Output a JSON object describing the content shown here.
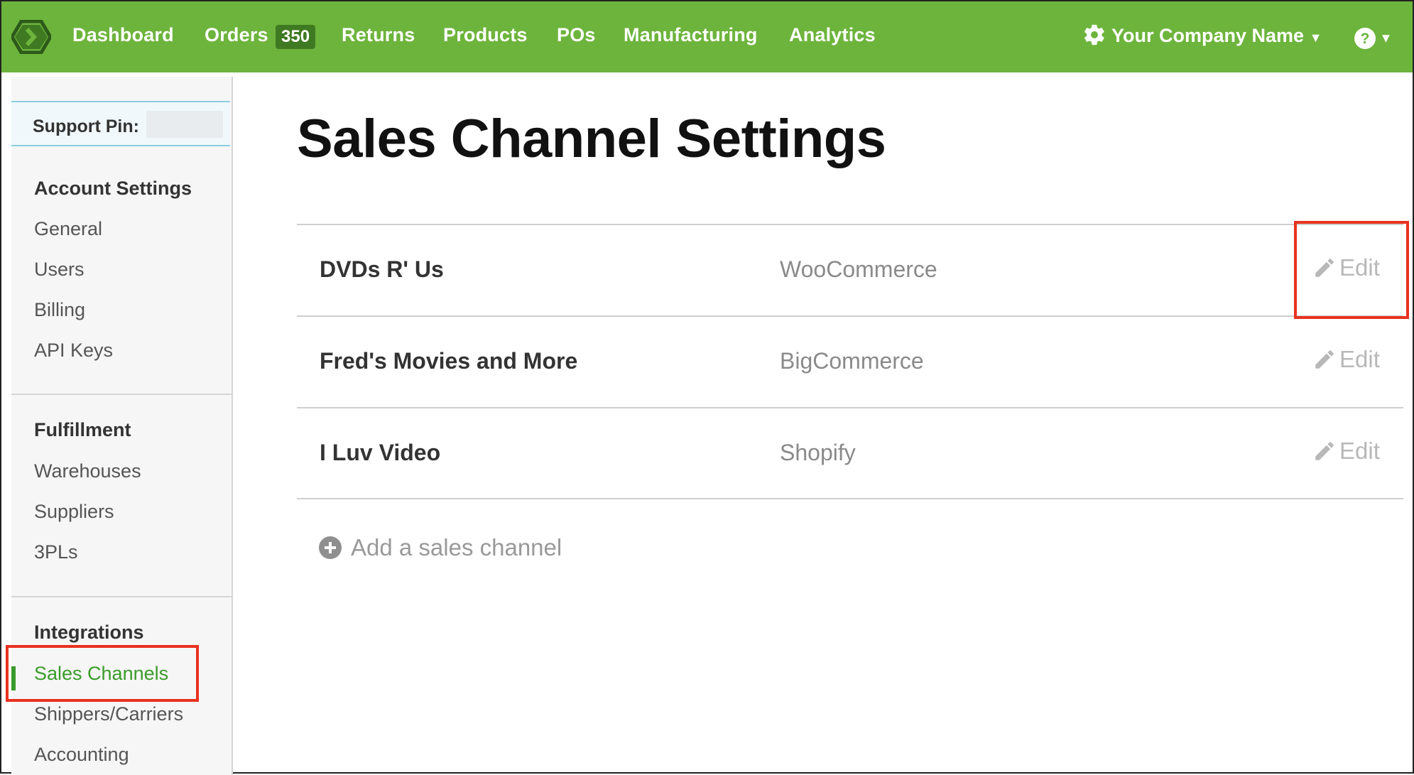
{
  "nav": {
    "items": [
      "Dashboard",
      "Orders",
      "Returns",
      "Products",
      "POs",
      "Manufacturing",
      "Analytics"
    ],
    "orders_badge": "350",
    "company": "Your Company Name",
    "help_icon": "question-icon",
    "colors": {
      "bar": "#6db43c",
      "badge": "#3f7a22"
    }
  },
  "sidebar": {
    "support_label": "Support Pin:",
    "sections": [
      {
        "heading": "Account Settings",
        "items": [
          "General",
          "Users",
          "Billing",
          "API Keys"
        ]
      },
      {
        "heading": "Fulfillment",
        "items": [
          "Warehouses",
          "Suppliers",
          "3PLs"
        ]
      },
      {
        "heading": "Integrations",
        "items": [
          "Sales Channels",
          "Shippers/Carriers",
          "Accounting"
        ]
      }
    ],
    "active_item": "Sales Channels"
  },
  "main": {
    "title": "Sales Channel Settings",
    "channels": [
      {
        "name": "DVDs R' Us",
        "platform": "WooCommerce",
        "action": "Edit"
      },
      {
        "name": "Fred's Movies and More",
        "platform": "BigCommerce",
        "action": "Edit"
      },
      {
        "name": "I Luv Video",
        "platform": "Shopify",
        "action": "Edit"
      }
    ],
    "add_label": "Add a sales channel"
  }
}
